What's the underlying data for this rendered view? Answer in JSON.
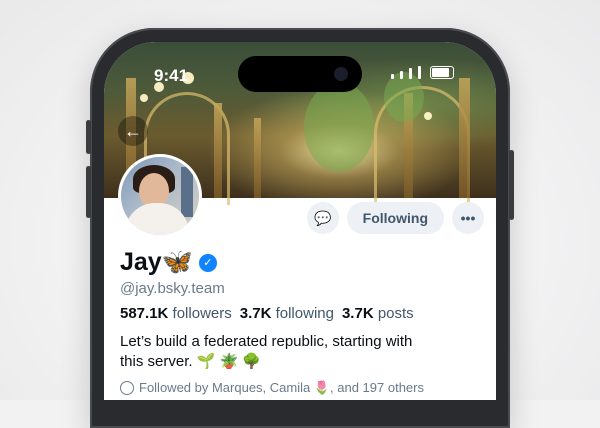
{
  "status_bar": {
    "time": "9:41"
  },
  "profile": {
    "display_name": "Jay",
    "name_emoji": "🦋",
    "handle": "@jay.bsky.team",
    "followers_count": "587.1K",
    "followers_label": "followers",
    "following_count": "3.7K",
    "following_label": "following",
    "posts_count": "3.7K",
    "posts_label": "posts",
    "bio_line1": "Let’s build a federated republic, starting with",
    "bio_line2": "this server. 🌱 🪴 🌳",
    "followed_by": "Followed by Marques, Camila 🌷, and 197 others"
  },
  "actions": {
    "following_label": "Following",
    "message_icon": "💬",
    "more_icon": "•••",
    "back_icon": "←",
    "verified_icon": "✓"
  },
  "colors": {
    "accent": "#1083fe",
    "button_bg": "#edf0f4",
    "muted_text": "#6a7a8c"
  }
}
